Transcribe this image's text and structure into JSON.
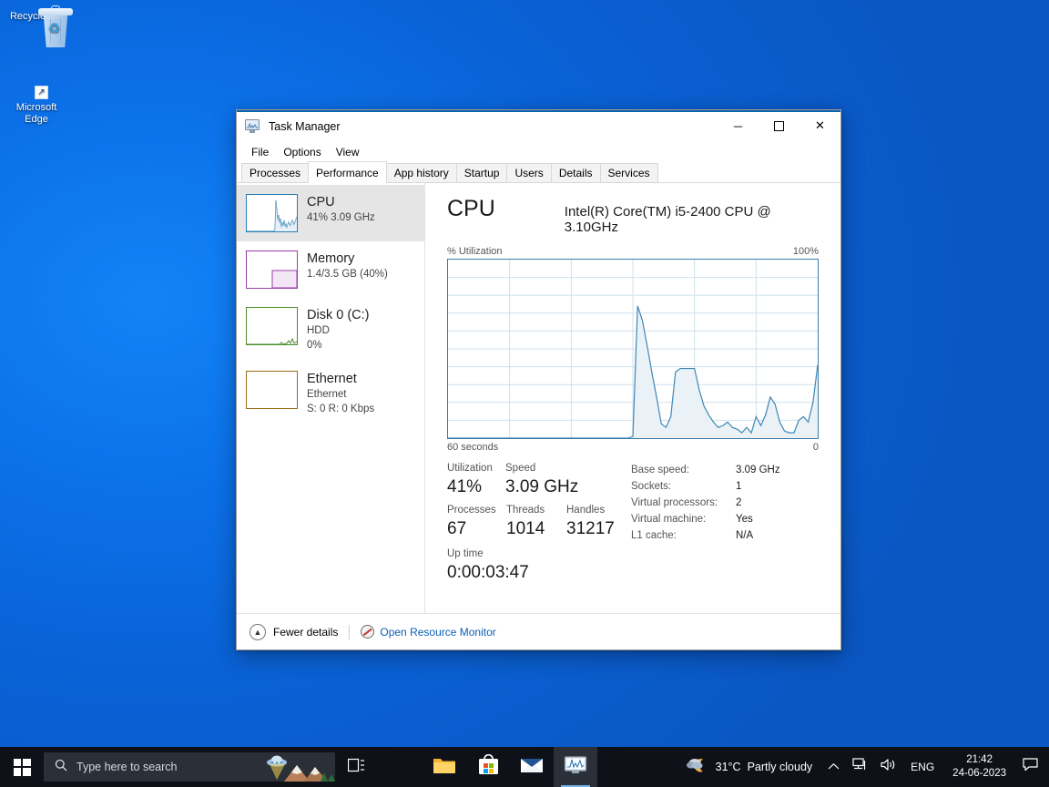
{
  "desktop": {
    "icons": [
      {
        "name": "Recycle Bin",
        "icon": "recycle-bin-icon"
      },
      {
        "name": "Microsoft\nEdge",
        "label_line1": "Microsoft",
        "label_line2": "Edge",
        "icon": "edge-icon"
      }
    ]
  },
  "window": {
    "title": "Task Manager",
    "icon": "task-manager-icon",
    "controls": {
      "minimize": "─",
      "maximize": "☐",
      "close": "✕"
    },
    "menu": [
      "File",
      "Options",
      "View"
    ],
    "tabs": [
      {
        "label": "Processes",
        "active": false
      },
      {
        "label": "Performance",
        "active": true
      },
      {
        "label": "App history",
        "active": false
      },
      {
        "label": "Startup",
        "active": false
      },
      {
        "label": "Users",
        "active": false
      },
      {
        "label": "Details",
        "active": false
      },
      {
        "label": "Services",
        "active": false
      }
    ],
    "sidebar": [
      {
        "title": "CPU",
        "sub1": "41%  3.09 GHz",
        "sub2": "",
        "color": "#2a7db5",
        "active": true
      },
      {
        "title": "Memory",
        "sub1": "1.4/3.5 GB (40%)",
        "sub2": "",
        "color": "#9b3fa8",
        "active": false
      },
      {
        "title": "Disk 0 (C:)",
        "sub1": "HDD",
        "sub2": "0%",
        "color": "#4a8c2a",
        "active": false
      },
      {
        "title": "Ethernet",
        "sub1": "Ethernet",
        "sub2": "S: 0 R: 0 Kbps",
        "color": "#9c6a16",
        "active": false
      }
    ],
    "detail": {
      "title": "CPU",
      "model": "Intel(R) Core(TM) i5-2400 CPU @ 3.10GHz",
      "axis_top_left": "% Utilization",
      "axis_top_right": "100%",
      "axis_bottom_left": "60 seconds",
      "axis_bottom_right": "0",
      "stats": {
        "utilization_label": "Utilization",
        "utilization_value": "41%",
        "speed_label": "Speed",
        "speed_value": "3.09 GHz",
        "processes_label": "Processes",
        "processes_value": "67",
        "threads_label": "Threads",
        "threads_value": "1014",
        "handles_label": "Handles",
        "handles_value": "31217",
        "uptime_label": "Up time",
        "uptime_value": "0:00:03:47"
      },
      "info": [
        {
          "key": "Base speed:",
          "value": "3.09 GHz"
        },
        {
          "key": "Sockets:",
          "value": "1"
        },
        {
          "key": "Virtual processors:",
          "value": "2"
        },
        {
          "key": "Virtual machine:",
          "value": "Yes"
        },
        {
          "key": "L1 cache:",
          "value": "N/A"
        }
      ]
    },
    "footer": {
      "chevron_icon": "chevron-up-icon",
      "fewer_details": "Fewer details",
      "resource_monitor_icon": "resource-monitor-icon",
      "resource_monitor": "Open Resource Monitor"
    }
  },
  "chart_data": {
    "type": "area",
    "title": "% Utilization",
    "xlabel": "60 seconds",
    "ylabel": "% Utilization",
    "xlim": [
      60,
      0
    ],
    "ylim": [
      0,
      100
    ],
    "ytick_labels": [
      "100%",
      "0"
    ],
    "grid": true,
    "line_color": "#3f87b5",
    "fill_color": "#eaf2f8",
    "series": [
      {
        "name": "CPU utilization",
        "x": [
          60,
          59,
          58,
          57,
          56,
          55,
          54,
          53,
          52,
          51,
          50,
          49,
          48,
          47,
          46,
          45,
          44,
          43,
          42,
          41,
          40,
          39,
          38,
          37,
          36,
          35,
          34,
          33,
          32,
          31,
          30,
          29,
          28,
          27,
          26,
          25,
          24,
          23,
          22,
          21,
          20,
          19,
          18,
          17,
          16,
          15,
          14,
          13,
          12,
          11,
          10,
          9,
          8,
          7,
          6,
          5,
          4,
          3,
          2,
          1,
          0
        ],
        "values": [
          0,
          0,
          0,
          0,
          0,
          0,
          0,
          0,
          0,
          0,
          0,
          0,
          0,
          0,
          0,
          0,
          0,
          0,
          0,
          0,
          0,
          0,
          0,
          0,
          0,
          0,
          0,
          0,
          0,
          0,
          0,
          0,
          0,
          0,
          0,
          0,
          0,
          0,
          0,
          1,
          74,
          66,
          52,
          37,
          23,
          8,
          6,
          12,
          37,
          39,
          39,
          39,
          39,
          27,
          18,
          13,
          9,
          6,
          7,
          9,
          6,
          5,
          3,
          6,
          3,
          12,
          7,
          13,
          23,
          19,
          9,
          4,
          3,
          3,
          10,
          12,
          9,
          20,
          41
        ]
      }
    ],
    "annotations": {
      "peak_value": 74,
      "current_value": 41
    }
  },
  "taskbar": {
    "start_icon": "windows-start-icon",
    "search": {
      "icon": "search-icon",
      "placeholder": "Type here to search"
    },
    "buttons": [
      {
        "name": "task-view",
        "icon": "task-view-icon"
      },
      {
        "name": "edge",
        "icon": "edge-icon"
      },
      {
        "name": "file-explorer",
        "icon": "folder-icon"
      },
      {
        "name": "microsoft-store",
        "icon": "store-icon"
      },
      {
        "name": "mail",
        "icon": "mail-icon"
      },
      {
        "name": "task-manager",
        "icon": "task-manager-icon",
        "active": true
      }
    ],
    "weather": {
      "icon": "partly-cloudy-night-icon",
      "temp": "31°C",
      "desc": "Partly cloudy"
    },
    "tray": {
      "chevron": "chevron-up-icon",
      "network": "network-icon",
      "volume": "speaker-icon",
      "language": "ENG"
    },
    "clock": {
      "time": "21:42",
      "date": "24-06-2023"
    },
    "action_center_icon": "notification-icon"
  }
}
